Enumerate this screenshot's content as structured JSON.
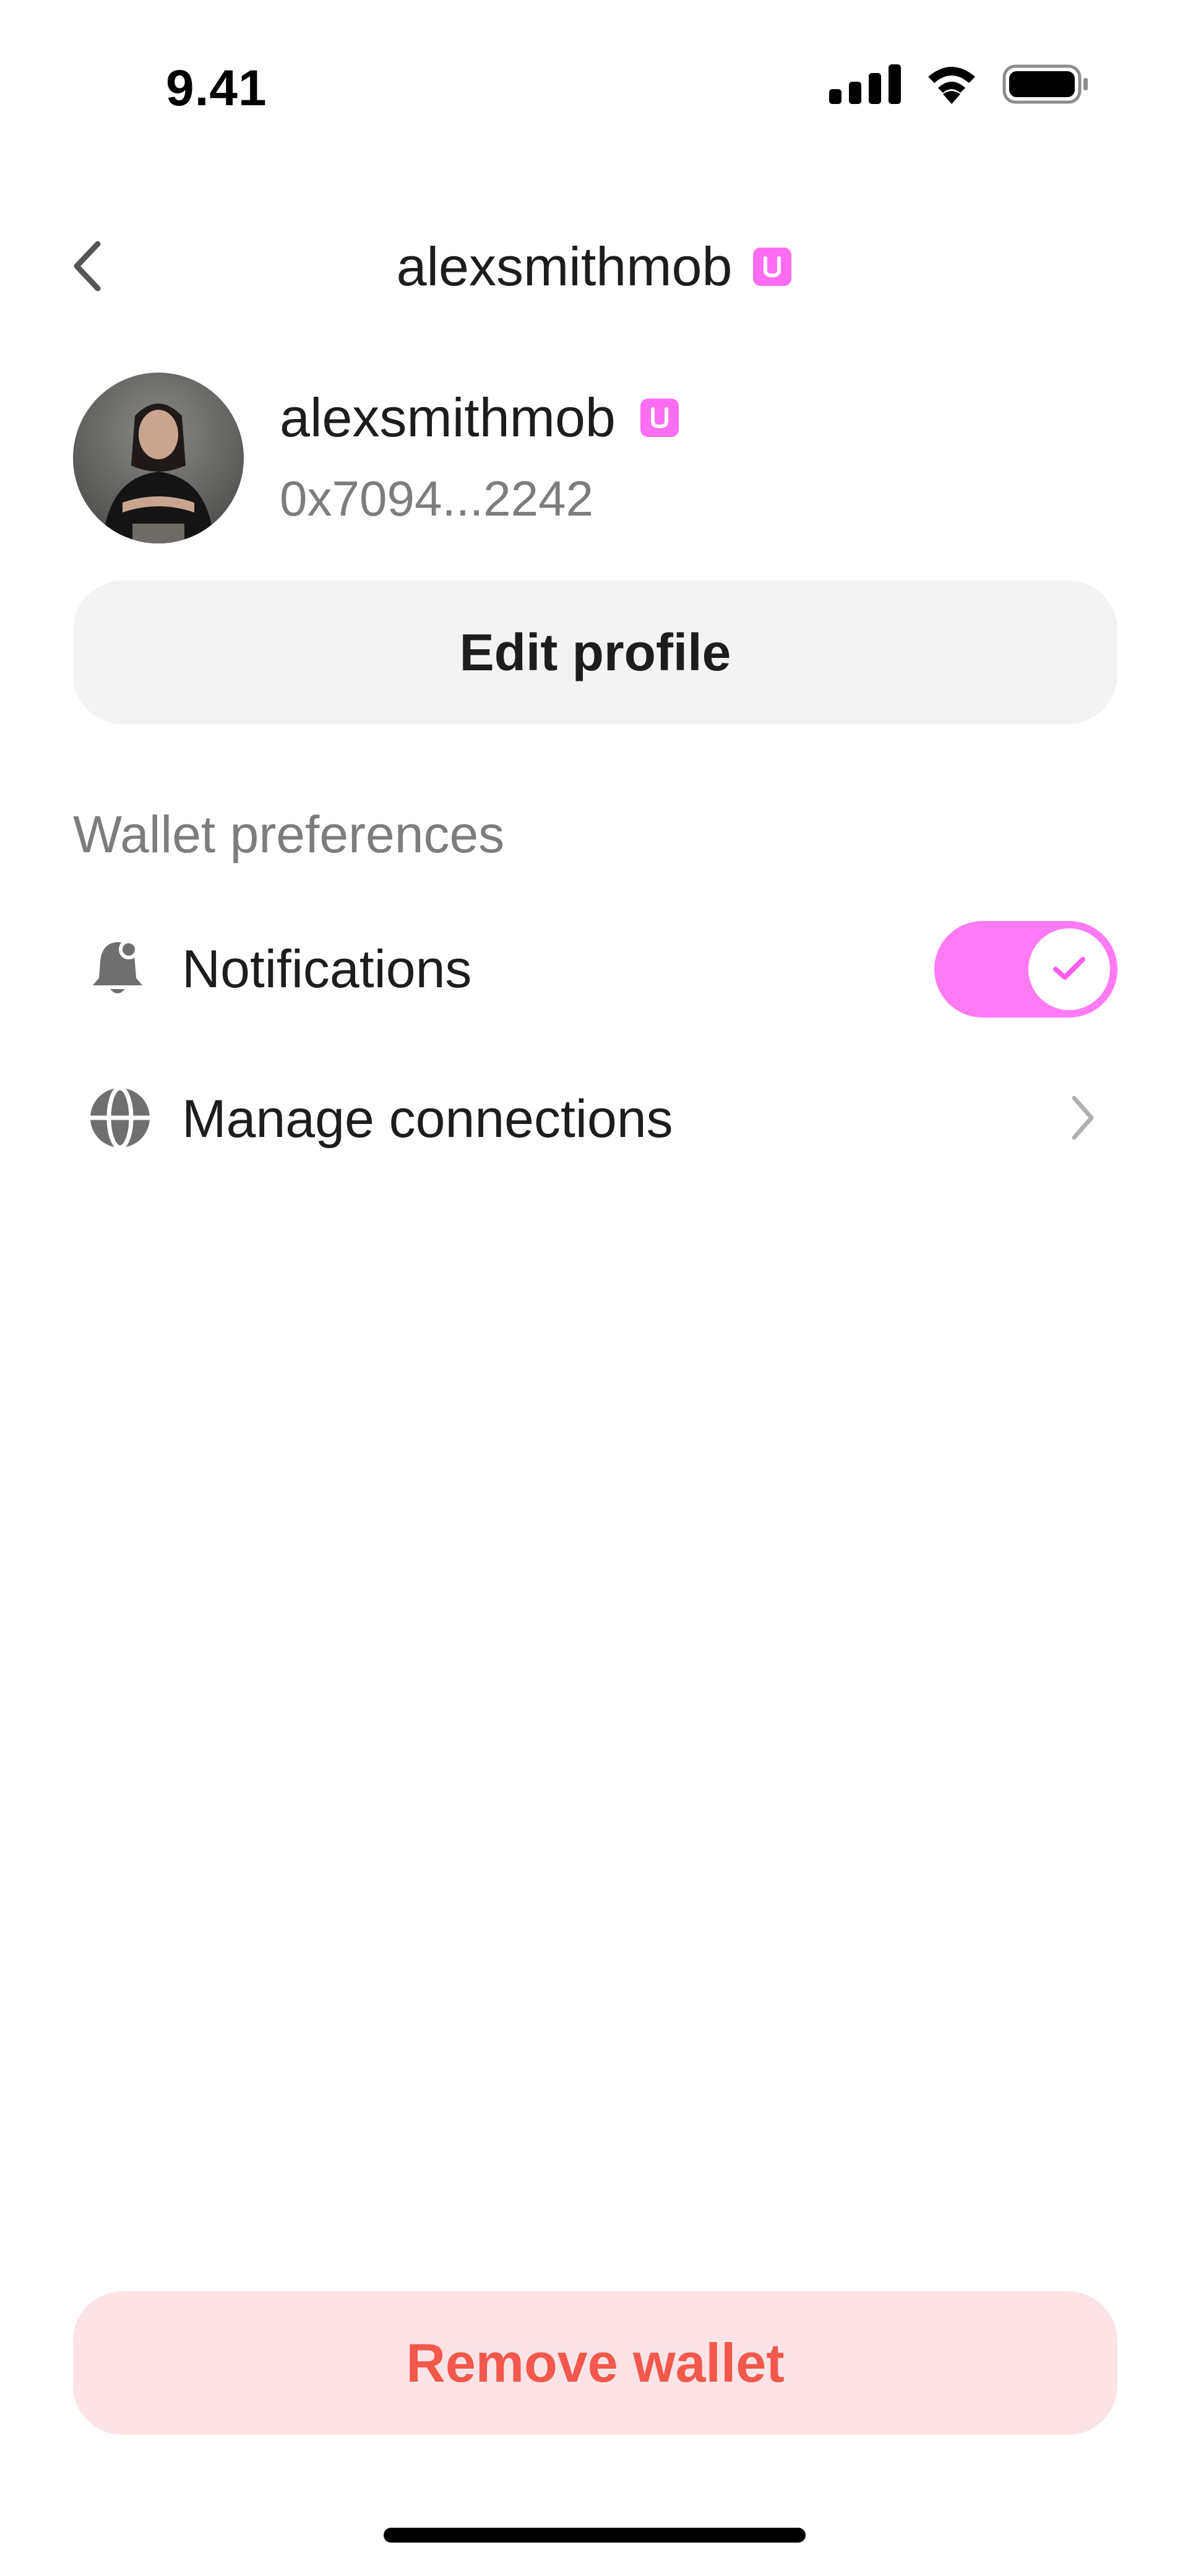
{
  "status_bar": {
    "time": "9.41",
    "icons": [
      "cellular-signal-icon",
      "wifi-icon",
      "battery-icon"
    ]
  },
  "header": {
    "back_icon": "chevron-left-icon",
    "title": "alexsmithmob",
    "badge_icon": "u-badge-icon"
  },
  "profile": {
    "name": "alexsmithmob",
    "badge_icon": "u-badge-icon",
    "address": "0x7094...2242",
    "avatar": "avatar-photo"
  },
  "edit_profile_label": "Edit profile",
  "wallet_preferences": {
    "section_label": "Wallet preferences",
    "items": [
      {
        "icon": "bell-icon",
        "label": "Notifications",
        "control": "toggle",
        "enabled": true
      },
      {
        "icon": "globe-icon",
        "label": "Manage connections",
        "control": "chevron-right-icon"
      }
    ]
  },
  "remove_wallet_label": "Remove wallet",
  "colors": {
    "accent": "#ff7bf5",
    "badge": "#ff6ef2",
    "danger_text": "#f2584b",
    "danger_bg": "#fde3e6",
    "button_bg": "#f3f3f3",
    "secondary_text": "#7d7d7d"
  }
}
